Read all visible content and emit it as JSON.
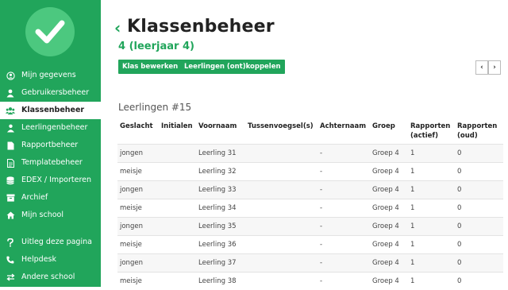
{
  "sidebar": {
    "items": [
      {
        "label": "Mijn gegevens",
        "icon": "user-circle-icon",
        "active": false
      },
      {
        "label": "Gebruikersbeheer",
        "icon": "user-icon",
        "active": false
      },
      {
        "label": "Klassenbeheer",
        "icon": "users-icon",
        "active": true
      },
      {
        "label": "Leerlingenbeheer",
        "icon": "student-icon",
        "active": false
      },
      {
        "label": "Rapportbeheer",
        "icon": "file-icon",
        "active": false
      },
      {
        "label": "Templatebeheer",
        "icon": "file-text-icon",
        "active": false
      },
      {
        "label": "EDEX / Importeren",
        "icon": "database-icon",
        "active": false
      },
      {
        "label": "Archief",
        "icon": "archive-icon",
        "active": false
      },
      {
        "label": "Mijn school",
        "icon": "home-icon",
        "active": false
      }
    ],
    "bottom_items": [
      {
        "label": "Uitleg deze pagina",
        "icon": "question-icon"
      },
      {
        "label": "Helpdesk",
        "icon": "phone-icon"
      },
      {
        "label": "Andere school",
        "icon": "exchange-icon"
      }
    ]
  },
  "header": {
    "back_glyph": "‹",
    "title": "Klassenbeheer",
    "subtitle": "4 (leerjaar 4)"
  },
  "toolbar": {
    "edit_class_label": "Klas bewerken",
    "link_students_label": "Leerlingen (ont)koppelen",
    "prev_glyph": "‹",
    "next_glyph": "›"
  },
  "students": {
    "section_title": "Leerlingen #15",
    "columns": [
      "Geslacht",
      "Initialen",
      "Voornaam",
      "Tussenvoegsel(s)",
      "Achternaam",
      "Groep",
      "Rapporten (actief)",
      "Rapporten (oud)"
    ],
    "rows": [
      [
        "jongen",
        "",
        "Leerling 31",
        "",
        "-",
        "Groep 4",
        "1",
        "0"
      ],
      [
        "meisje",
        "",
        "Leerling 32",
        "",
        "-",
        "Groep 4",
        "1",
        "0"
      ],
      [
        "jongen",
        "",
        "Leerling 33",
        "",
        "-",
        "Groep 4",
        "1",
        "0"
      ],
      [
        "meisje",
        "",
        "Leerling 34",
        "",
        "-",
        "Groep 4",
        "1",
        "0"
      ],
      [
        "jongen",
        "",
        "Leerling 35",
        "",
        "-",
        "Groep 4",
        "1",
        "0"
      ],
      [
        "meisje",
        "",
        "Leerling 36",
        "",
        "-",
        "Groep 4",
        "1",
        "0"
      ],
      [
        "jongen",
        "",
        "Leerling 37",
        "",
        "-",
        "Groep 4",
        "1",
        "0"
      ],
      [
        "meisje",
        "",
        "Leerling 38",
        "",
        "-",
        "Groep 4",
        "1",
        "0"
      ]
    ]
  },
  "colors": {
    "accent": "#21a55b",
    "logo": "#4cc87f"
  }
}
